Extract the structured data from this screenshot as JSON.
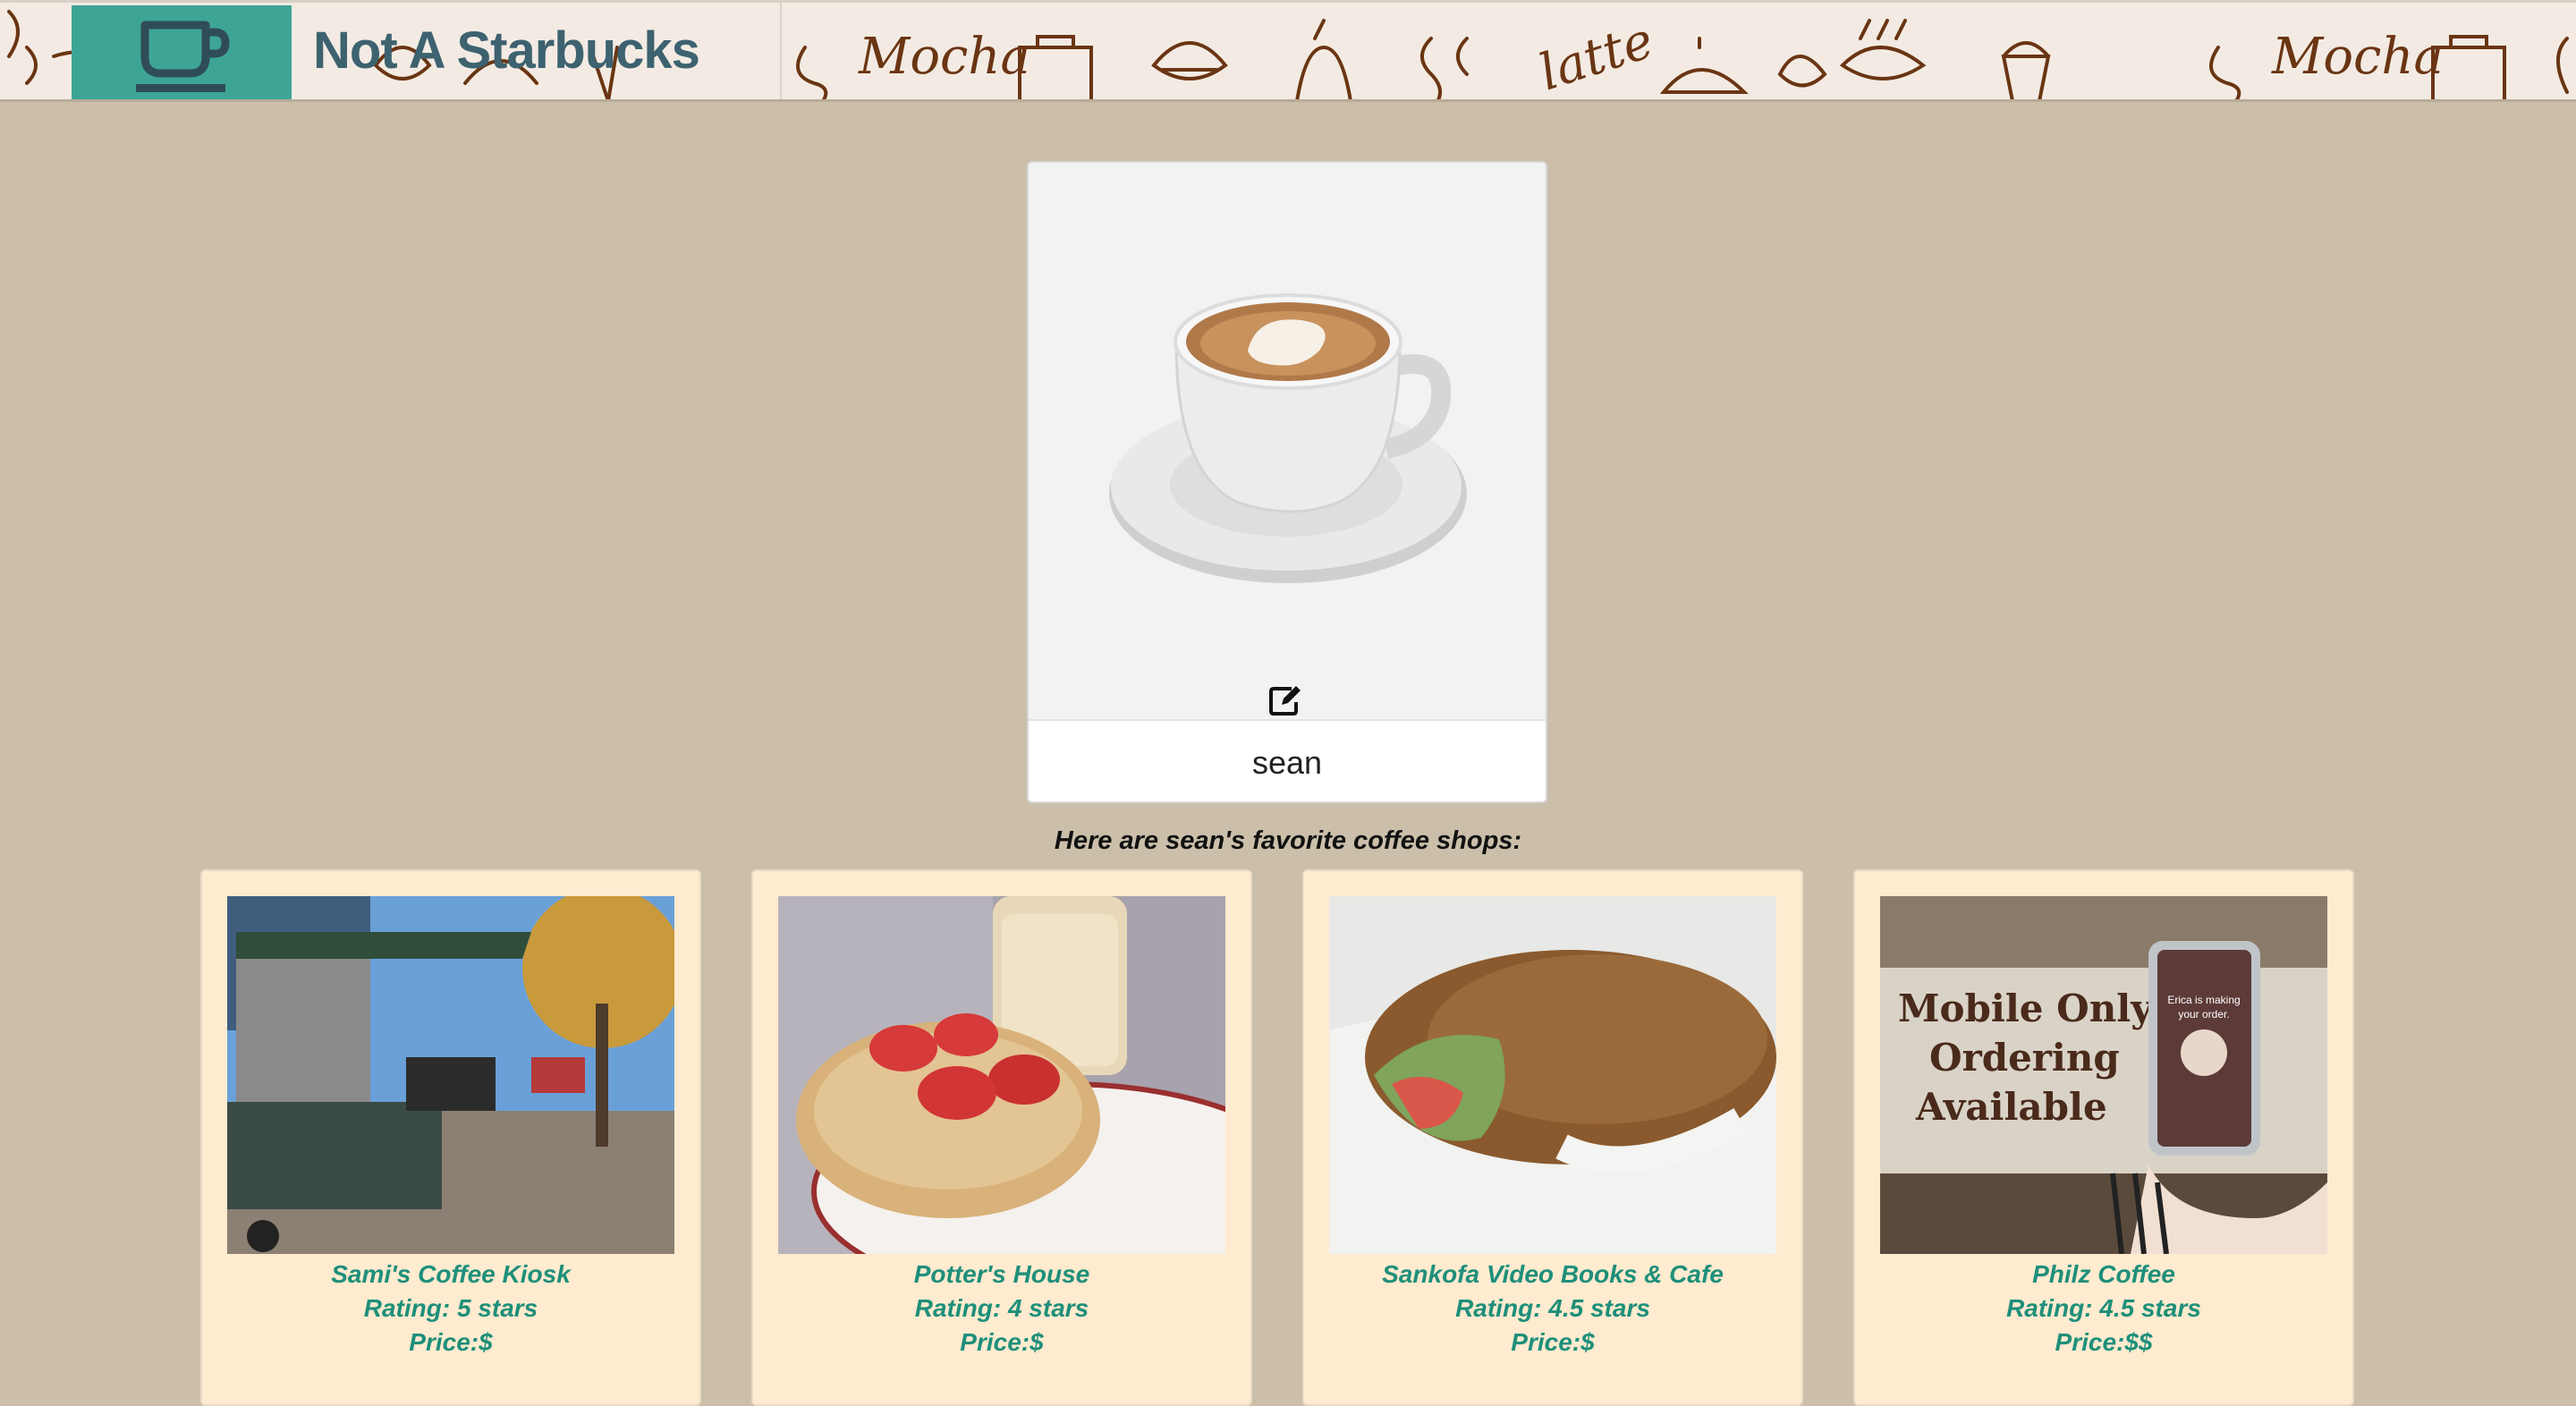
{
  "header": {
    "brand": "Not A Starbucks",
    "logo_icon": "coffee-cup-icon",
    "doodle_words": [
      "Mocha",
      "latte",
      "Mocha"
    ]
  },
  "profile": {
    "name": "sean",
    "edit_icon": "edit-icon"
  },
  "favorites_heading": "Here are sean's favorite coffee shops:",
  "shops": [
    {
      "name": "Sami's Coffee Kiosk",
      "rating": "Rating: 5 stars",
      "price": "Price:$"
    },
    {
      "name": "Potter's House",
      "rating": "Rating: 4 stars",
      "price": "Price:$"
    },
    {
      "name": "Sankofa Video Books & Cafe",
      "rating": "Rating: 4.5 stars",
      "price": "Price:$"
    },
    {
      "name": "Philz Coffee",
      "rating": "Rating: 4.5 stars",
      "price": "Price:$$",
      "photo_text": [
        "Mobile Only",
        "Ordering",
        "Available"
      ],
      "phone_text": [
        "Erica is making",
        "your order."
      ]
    }
  ],
  "colors": {
    "page_bg": "#cbbfaa",
    "header_bg": "#f3ebe3",
    "logo_bg": "#3ea596",
    "brand_text": "#3d6270",
    "card_bg": "#ffebcf",
    "shop_text": "#1e8f7a"
  }
}
